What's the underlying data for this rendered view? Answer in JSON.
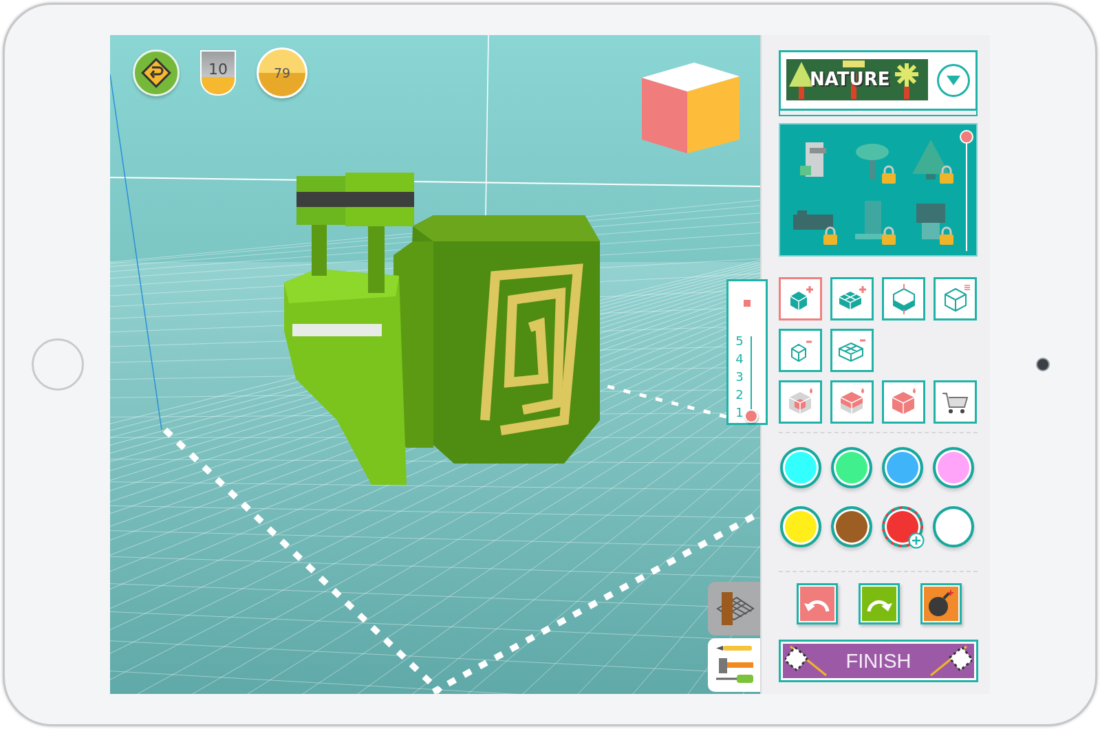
{
  "hud": {
    "level": "10",
    "coins": "79"
  },
  "catalog": {
    "title": "NATURE",
    "items": [
      {
        "kind": "rock",
        "locked": false
      },
      {
        "kind": "palm",
        "locked": true
      },
      {
        "kind": "pine",
        "locked": true
      },
      {
        "kind": "log",
        "locked": true
      },
      {
        "kind": "waterfall",
        "locked": true
      },
      {
        "kind": "bush",
        "locked": true
      }
    ]
  },
  "layer_slider": {
    "labels": [
      "5",
      "4",
      "3",
      "2",
      "1"
    ],
    "level": 0
  },
  "tools": [
    {
      "kind": "add-block",
      "selected": true
    },
    {
      "kind": "add-group",
      "selected": false
    },
    {
      "kind": "resize",
      "selected": false
    },
    {
      "kind": "frame",
      "selected": false
    },
    {
      "kind": "remove-block",
      "selected": false
    },
    {
      "kind": "remove-group",
      "selected": false
    },
    {
      "kind": "paint-one",
      "selected": false
    },
    {
      "kind": "paint-layer",
      "selected": false
    },
    {
      "kind": "paint-all",
      "selected": false
    },
    {
      "kind": "shop",
      "selected": false
    }
  ],
  "palette": [
    {
      "color": "#33ffff",
      "selected": false
    },
    {
      "color": "#40f08c",
      "selected": false
    },
    {
      "color": "#40b4f8",
      "selected": false
    },
    {
      "color": "#ffa4f8",
      "selected": false
    },
    {
      "color": "#ffee1a",
      "selected": false
    },
    {
      "color": "#9c5e22",
      "selected": false
    },
    {
      "color": "#f03434",
      "selected": true
    },
    {
      "color": "#ffffff",
      "selected": false
    }
  ],
  "actions": [
    {
      "kind": "undo"
    },
    {
      "kind": "redo"
    },
    {
      "kind": "clear"
    }
  ],
  "finish": {
    "label": "FINISH"
  },
  "mode_tabs": [
    {
      "kind": "grid",
      "selected": true
    },
    {
      "kind": "tools",
      "selected": false
    }
  ]
}
